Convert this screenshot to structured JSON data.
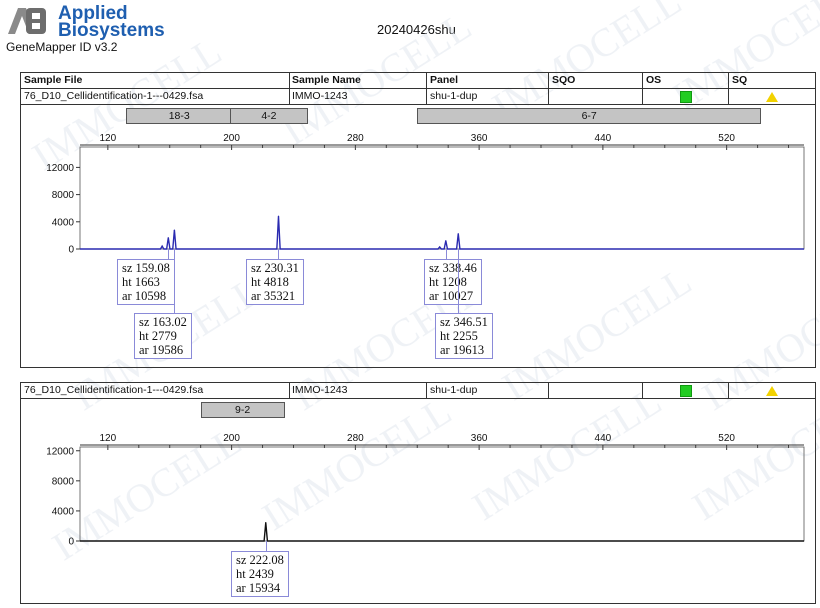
{
  "header": {
    "logo_text": "AB",
    "brand_line1": "Applied",
    "brand_line2": "Biosystems",
    "software": "GeneMapper ID v3.2",
    "run_title": "20240426shu",
    "watermark": "IMMOCELL"
  },
  "table_headers": [
    "Sample File",
    "Sample Name",
    "Panel",
    "SQO",
    "OS",
    "SQ"
  ],
  "colors": {
    "trace_blue": "#2a2ab0",
    "trace_black": "#111111",
    "os_green": "#22cc22",
    "sq_yellow": "#f2d200",
    "bin_gray": "#c4c4c4"
  },
  "panels": [
    {
      "sample_file": "76_D10_Cellidentification-1---0429.fsa",
      "sample_name": "IMMO-1243",
      "panel": "shu-1-dup",
      "sqo": "",
      "os_icon": "green-square-icon",
      "sq_icon": "yellow-triangle-icon",
      "bins": [
        {
          "label": "18-3",
          "start": 132,
          "end": 199
        },
        {
          "label": "4-2",
          "start": 199,
          "end": 248
        },
        {
          "label": "6-7",
          "start": 320,
          "end": 541
        }
      ],
      "peak_labels": [
        {
          "sz": "sz 159.08",
          "ht": "ht 1663",
          "ar": "ar 10598"
        },
        {
          "sz": "sz 163.02",
          "ht": "ht 2779",
          "ar": "ar 19586"
        },
        {
          "sz": "sz 230.31",
          "ht": "ht 4818",
          "ar": "ar 35321"
        },
        {
          "sz": "sz 338.46",
          "ht": "ht 1208",
          "ar": "ar 10027"
        },
        {
          "sz": "sz 346.51",
          "ht": "ht 2255",
          "ar": "ar 19613"
        }
      ]
    },
    {
      "sample_file": "76_D10_Cellidentification-1---0429.fsa",
      "sample_name": "IMMO-1243",
      "panel": "shu-1-dup",
      "sqo": "",
      "os_icon": "green-square-icon",
      "sq_icon": "yellow-triangle-icon",
      "bins": [
        {
          "label": "9-2",
          "start": 180,
          "end": 233
        }
      ],
      "peak_labels": [
        {
          "sz": "sz 222.08",
          "ht": "ht 2439",
          "ar": "ar 15934"
        }
      ]
    }
  ],
  "chart_data": [
    {
      "type": "line",
      "title": "",
      "xlabel": "",
      "ylabel": "",
      "xlim": [
        102,
        570
      ],
      "ylim": [
        0,
        15000
      ],
      "x_ticks": [
        120,
        200,
        280,
        360,
        440,
        520
      ],
      "y_ticks": [
        0,
        4000,
        8000,
        12000
      ],
      "grid": false,
      "series": [
        {
          "color": "#2a2ab0",
          "peaks": [
            {
              "x": 155.1,
              "y": 420
            },
            {
              "x": 159.08,
              "y": 1663
            },
            {
              "x": 163.02,
              "y": 2779
            },
            {
              "x": 230.31,
              "y": 4818
            },
            {
              "x": 334.5,
              "y": 300
            },
            {
              "x": 338.46,
              "y": 1208
            },
            {
              "x": 346.51,
              "y": 2255
            }
          ]
        }
      ]
    },
    {
      "type": "line",
      "title": "",
      "xlabel": "",
      "ylabel": "",
      "xlim": [
        102,
        570
      ],
      "ylim": [
        0,
        12500
      ],
      "x_ticks": [
        120,
        200,
        280,
        360,
        440,
        520
      ],
      "y_ticks": [
        0,
        4000,
        8000,
        12000
      ],
      "grid": false,
      "series": [
        {
          "color": "#111111",
          "peaks": [
            {
              "x": 222.08,
              "y": 2439
            }
          ]
        }
      ]
    }
  ]
}
